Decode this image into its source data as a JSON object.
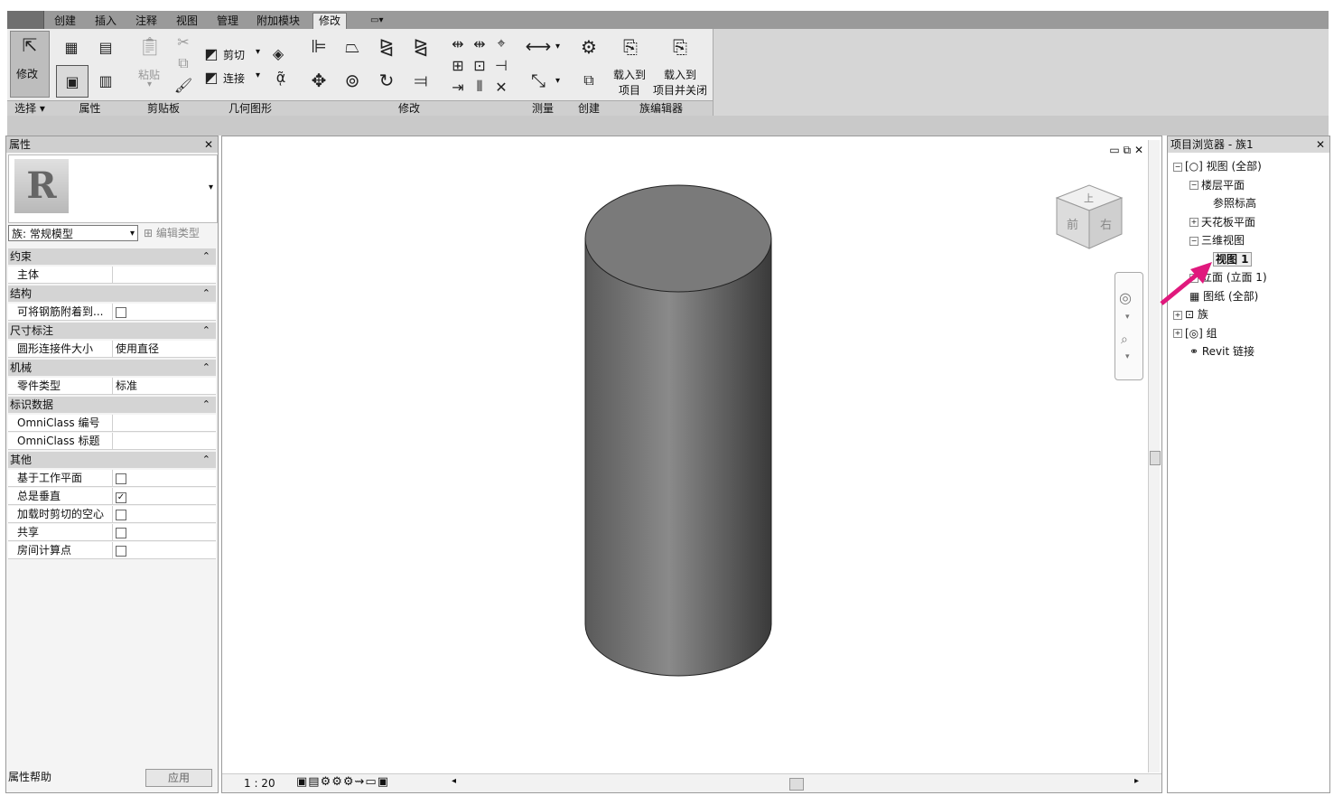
{
  "tabs": [
    "创建",
    "插入",
    "注释",
    "视图",
    "管理",
    "附加模块",
    "修改"
  ],
  "active_tab_index": 6,
  "qat_icon": "dropdown-arrow-icon",
  "ribbon": {
    "select": {
      "button_label": "修改",
      "panel_title": "选择 ▾"
    },
    "properties": {
      "panel_title": "属性"
    },
    "clipboard": {
      "paste_label": "粘贴",
      "panel_title": "剪贴板"
    },
    "geometry": {
      "cut_label": "剪切",
      "join_label": "连接",
      "panel_title": "几何图形"
    },
    "modify": {
      "panel_title": "修改"
    },
    "measure": {
      "panel_title": "测量"
    },
    "create": {
      "panel_title": "创建"
    },
    "family_editor": {
      "load_into_project": [
        "载入到",
        "项目"
      ],
      "load_and_close": [
        "载入到",
        "项目并关闭"
      ],
      "panel_title": "族编辑器"
    }
  },
  "properties_panel": {
    "title": "属性",
    "type_selector": "族: 常规模型",
    "edit_type": "编辑类型",
    "groups": [
      {
        "name": "约束",
        "rows": [
          {
            "key": "主体",
            "value": ""
          }
        ]
      },
      {
        "name": "结构",
        "rows": [
          {
            "key": "可将钢筋附着到...",
            "checkbox": false
          }
        ]
      },
      {
        "name": "尺寸标注",
        "rows": [
          {
            "key": "圆形连接件大小",
            "value": "使用直径"
          }
        ]
      },
      {
        "name": "机械",
        "rows": [
          {
            "key": "零件类型",
            "value": "标准"
          }
        ]
      },
      {
        "name": "标识数据",
        "rows": [
          {
            "key": "OmniClass 编号",
            "value": ""
          },
          {
            "key": "OmniClass 标题",
            "value": ""
          }
        ]
      },
      {
        "name": "其他",
        "rows": [
          {
            "key": "基于工作平面",
            "checkbox": false
          },
          {
            "key": "总是垂直",
            "checkbox": true
          },
          {
            "key": "加载时剪切的空心",
            "checkbox": false
          },
          {
            "key": "共享",
            "checkbox": false
          },
          {
            "key": "房间计算点",
            "checkbox": false
          }
        ]
      }
    ],
    "help_link": "属性帮助",
    "apply_button": "应用"
  },
  "viewport": {
    "scale": "1 : 20",
    "viewcube_faces": [
      "上",
      "前",
      "右"
    ]
  },
  "project_browser": {
    "title": "项目浏览器 - 族1",
    "nodes": [
      {
        "label": "视图 (全部)",
        "toggle": "−"
      },
      {
        "label": "楼层平面",
        "toggle": "−"
      },
      {
        "label": "参照标高",
        "toggle": ""
      },
      {
        "label": "天花板平面",
        "toggle": "+"
      },
      {
        "label": "三维视图",
        "toggle": "−"
      },
      {
        "label": "视图 1",
        "toggle": ""
      },
      {
        "label": "立面 (立面 1)",
        "toggle": "+"
      },
      {
        "label": "图纸 (全部)",
        "toggle": ""
      },
      {
        "label": "族",
        "toggle": "+"
      },
      {
        "label": "组",
        "toggle": "+"
      },
      {
        "label": "Revit 链接",
        "toggle": ""
      }
    ]
  },
  "colors": {
    "annotation_arrow": "#e0197d",
    "cylinder_dark": "#3a3a3a",
    "cylinder_light": "#8a8a8a"
  }
}
